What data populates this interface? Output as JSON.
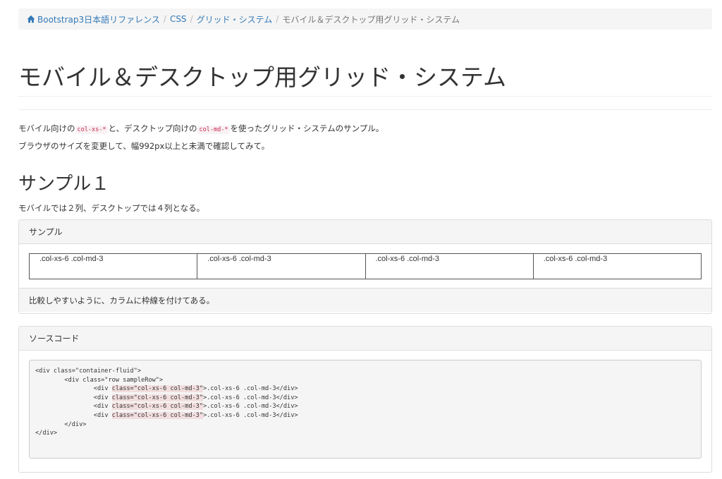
{
  "breadcrumb": {
    "home": "Bootstrap3日本語リファレンス",
    "css": "CSS",
    "grid": "グリッド・システム",
    "current": "モバイル＆デスクトップ用グリッド・システム",
    "separator": "/"
  },
  "page_title": "モバイル＆デスクトップ用グリッド・システム",
  "intro": {
    "line1_a": "モバイル向けの",
    "code1": "col-xs-*",
    "line1_b": "と、デスクトップ向けの",
    "code2": "col-md-*",
    "line1_c": "を使ったグリッド・システムのサンプル。",
    "line2": "ブラウザのサイズを変更して、幅992px以上と未満で確認してみて。"
  },
  "sample": {
    "title": "サンプル１",
    "description": "モバイルでは２列、デスクトップでは４列となる。",
    "panel_heading": "サンプル",
    "cells": [
      ".col-xs-6 .col-md-3",
      ".col-xs-6 .col-md-3",
      ".col-xs-6 .col-md-3",
      ".col-xs-6 .col-md-3"
    ],
    "footer": "比較しやすいように、カラムに枠線を付けてある。"
  },
  "source": {
    "panel_heading": "ソースコード",
    "line1": "<div class=\"container-fluid\">",
    "line2": "        <div class=\"row sampleRow\">",
    "indent": "                ",
    "inner_open": "<div ",
    "inner_class": "class=\"col-xs-6 col-md-3\"",
    "inner_close": ">.col-xs-6 .col-md-3</div>",
    "line7": "        </div>",
    "line8": "</div>"
  },
  "colors": {
    "link": "#337ab7",
    "code_text": "#c7254e",
    "highlight": "#f2dede"
  }
}
